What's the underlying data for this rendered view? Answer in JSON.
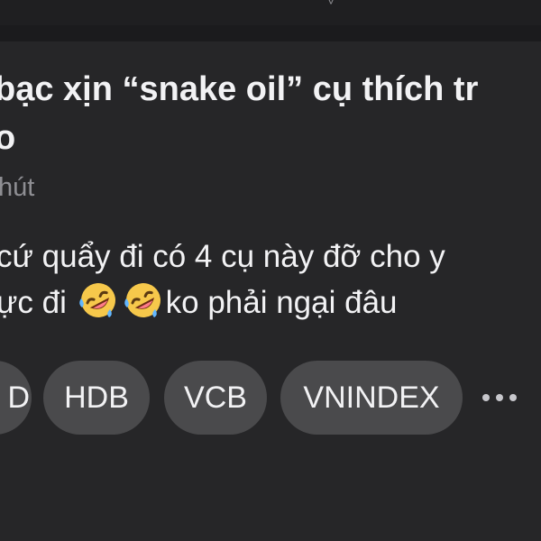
{
  "header": {
    "glyph": "˅"
  },
  "post": {
    "title": "bạc xịn  “snake oil” cụ thích tr",
    "title_line2": "o",
    "time": "hút",
    "body_line1": "cứ quẩy đi có 4 cụ này đỡ cho y",
    "body_line2_prefix": "ực đi ",
    "body_line2_suffix": "ko phải ngại đâu",
    "emoji_icon": "rolling-on-floor-laughing-icon"
  },
  "tags": [
    {
      "label": "D"
    },
    {
      "label": "HDB"
    },
    {
      "label": "VCB"
    },
    {
      "label": "VNINDEX"
    }
  ],
  "more": {
    "icon": "more-horizontal-icon"
  },
  "colors": {
    "background": "#1b1b1d",
    "card": "#262628",
    "text": "#f2f2f4",
    "secondary_text": "#8e8e93",
    "chip": "#4a4a4c"
  }
}
